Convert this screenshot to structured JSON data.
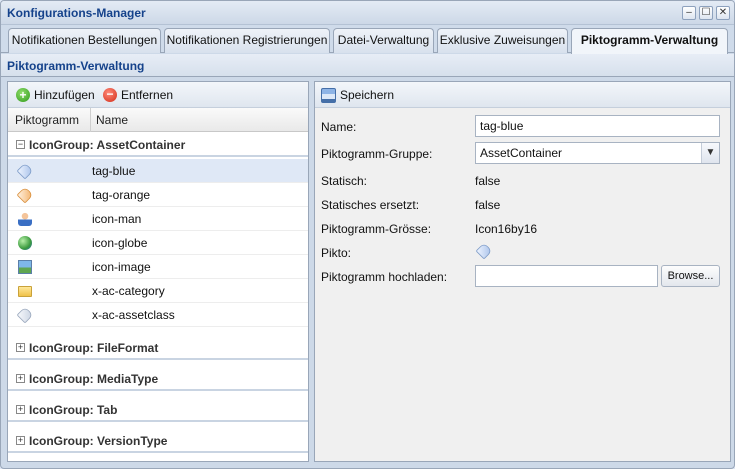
{
  "window": {
    "title": "Konfigurations-Manager",
    "min_glyph": "–",
    "max_glyph": "☐",
    "close_glyph": "✕"
  },
  "tabs": [
    {
      "label": "Notifikationen Bestellungen",
      "active": false
    },
    {
      "label": "Notifikationen Registrierungen",
      "active": false
    },
    {
      "label": "Datei-Verwaltung",
      "active": false
    },
    {
      "label": "Exklusive Zuweisungen",
      "active": false
    },
    {
      "label": "Piktogramm-Verwaltung",
      "active": true
    }
  ],
  "panel_title": "Piktogramm-Verwaltung",
  "left": {
    "add_label": "Hinzufügen",
    "remove_label": "Entfernen",
    "columns": [
      "Piktogramm",
      "Name"
    ],
    "groups": [
      {
        "label": "IconGroup: AssetContainer",
        "expanded": true,
        "toggle": "−",
        "items": [
          {
            "name": "tag-blue",
            "icon": "tag-blue-icon",
            "selected": true
          },
          {
            "name": "tag-orange",
            "icon": "tag-orange-icon",
            "selected": false
          },
          {
            "name": "icon-man",
            "icon": "man-icon",
            "selected": false
          },
          {
            "name": "icon-globe",
            "icon": "globe-icon",
            "selected": false
          },
          {
            "name": "icon-image",
            "icon": "image-icon",
            "selected": false
          },
          {
            "name": "x-ac-category",
            "icon": "folder-icon",
            "selected": false
          },
          {
            "name": "x-ac-assetclass",
            "icon": "tag-grey-icon",
            "selected": false
          }
        ]
      },
      {
        "label": "IconGroup: FileFormat",
        "expanded": false,
        "toggle": "+"
      },
      {
        "label": "IconGroup: MediaType",
        "expanded": false,
        "toggle": "+"
      },
      {
        "label": "IconGroup: Tab",
        "expanded": false,
        "toggle": "+"
      },
      {
        "label": "IconGroup: VersionType",
        "expanded": false,
        "toggle": "+"
      }
    ]
  },
  "right": {
    "save_label": "Speichern",
    "form": {
      "name_label": "Name:",
      "name_value": "tag-blue",
      "group_label": "Piktogramm-Gruppe:",
      "group_value": "AssetContainer",
      "static_label": "Statisch:",
      "static_value": "false",
      "static_replaced_label": "Statisches ersetzt:",
      "static_replaced_value": "false",
      "size_label": "Piktogramm-Grösse:",
      "size_value": "Icon16by16",
      "pikto_label": "Pikto:",
      "upload_label": "Piktogramm hochladen:",
      "upload_value": "",
      "browse_label": "Browse..."
    }
  },
  "colors": {
    "title_text": "#15428b",
    "selected_row": "#dfe8f6",
    "border": "#99a6b8"
  }
}
